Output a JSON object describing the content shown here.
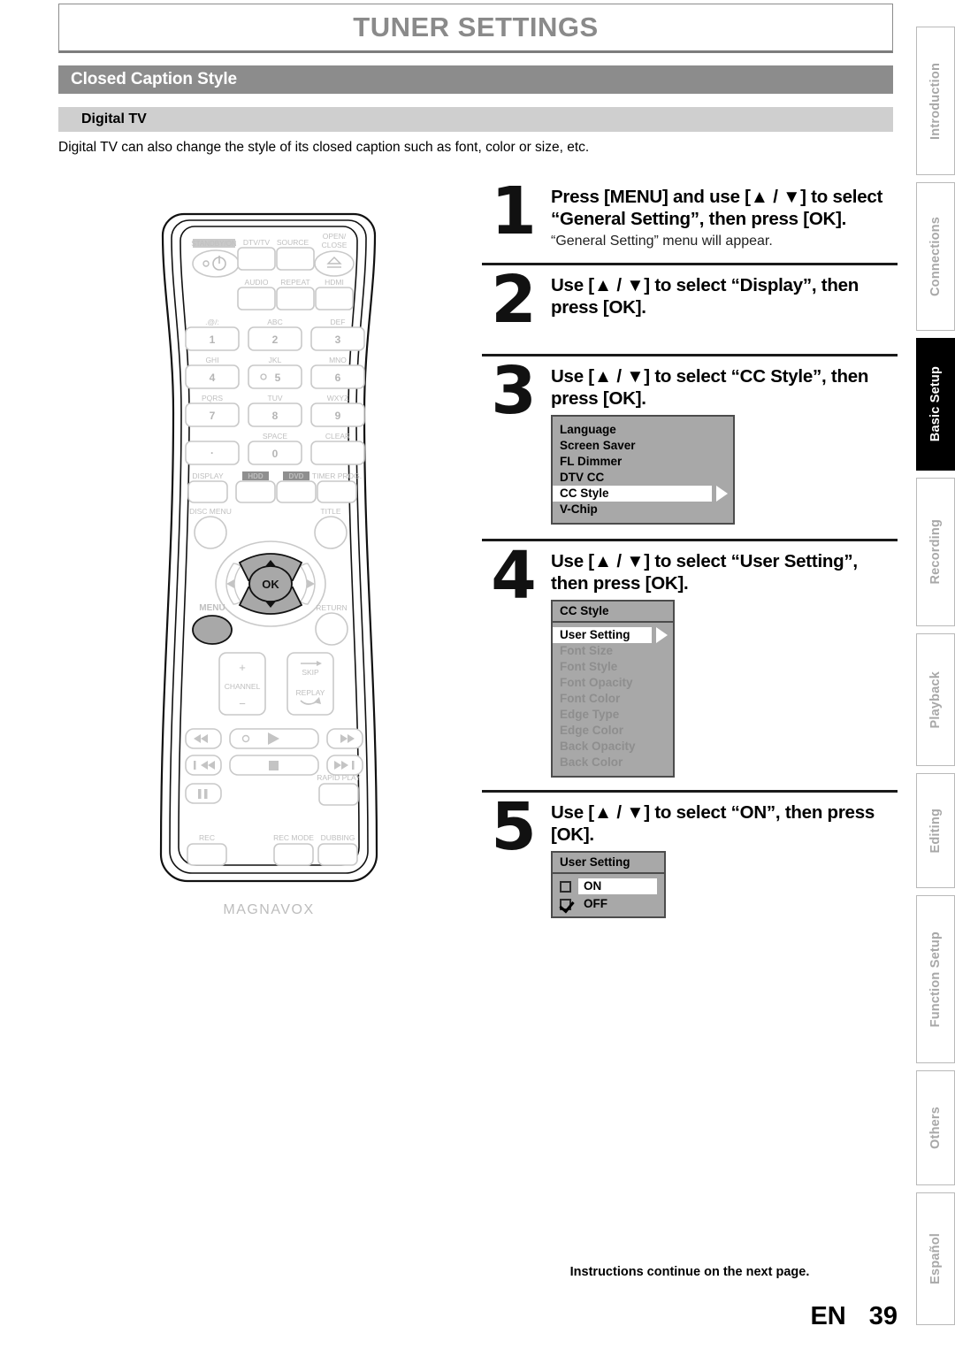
{
  "header": {
    "title": "TUNER SETTINGS",
    "section": "Closed Caption Style",
    "subsection": "Digital TV",
    "intro": "Digital TV can also change the style of its closed caption such as font, color or size, etc."
  },
  "tabs": [
    {
      "label": "Introduction",
      "active": false
    },
    {
      "label": "Connections",
      "active": false
    },
    {
      "label": "Basic Setup",
      "active": true
    },
    {
      "label": "Recording",
      "active": false
    },
    {
      "label": "Playback",
      "active": false
    },
    {
      "label": "Editing",
      "active": false
    },
    {
      "label": "Function Setup",
      "active": false
    },
    {
      "label": "Others",
      "active": false
    },
    {
      "label": "Español",
      "active": false
    }
  ],
  "steps": [
    {
      "number": "1",
      "title": "Press [MENU] and use [▲ / ▼] to select “General Setting”, then press [OK].",
      "subtitle": "“General Setting” menu will appear."
    },
    {
      "number": "2",
      "title": "Use [▲ / ▼] to select “Display”, then press [OK].",
      "subtitle": ""
    },
    {
      "number": "3",
      "title": "Use [▲ / ▼] to select “CC Style”, then press [OK].",
      "subtitle": ""
    },
    {
      "number": "4",
      "title": "Use [▲ / ▼] to select “User Setting”, then press [OK].",
      "subtitle": ""
    },
    {
      "number": "5",
      "title": "Use [▲ / ▼] to select “ON”, then press [OK].",
      "subtitle": ""
    }
  ],
  "osd_step3": {
    "items": [
      "Language",
      "Screen Saver",
      "FL Dimmer",
      "DTV CC",
      "CC Style",
      "V-Chip"
    ],
    "selected": "CC Style"
  },
  "osd_step4": {
    "header": "CC Style",
    "selected": "User Setting",
    "items": [
      "Font Size",
      "Font Style",
      "Font Opacity",
      "Font Color",
      "Edge Type",
      "Edge Color",
      "Back Opacity",
      "Back Color"
    ]
  },
  "osd_step5": {
    "header": "User Setting",
    "options": [
      {
        "label": "ON",
        "checked": false,
        "selected": true
      },
      {
        "label": "OFF",
        "checked": true,
        "selected": false
      }
    ]
  },
  "footer": {
    "note": "Instructions continue on the next page.",
    "lang": "EN",
    "page": "39"
  },
  "remote": {
    "brand": "MAGNAVOX",
    "standby_label": "STANDBY/ON",
    "buttons_row1": [
      "DTV/TV",
      "SOURCE"
    ],
    "open_close": "OPEN/\nCLOSE",
    "buttons_row2": [
      "AUDIO",
      "REPEAT",
      "HDMI"
    ],
    "keypad": [
      {
        "sub": ".@/:",
        "num": "1"
      },
      {
        "sub": "ABC",
        "num": "2"
      },
      {
        "sub": "DEF",
        "num": "3"
      },
      {
        "sub": "GHI",
        "num": "4"
      },
      {
        "sub": "JKL",
        "num": "5"
      },
      {
        "sub": "MNO",
        "num": "6"
      },
      {
        "sub": "PQRS",
        "num": "7"
      },
      {
        "sub": "TUV",
        "num": "8"
      },
      {
        "sub": "WXYZ",
        "num": "9"
      },
      {
        "sub": "",
        "num": "·"
      },
      {
        "sub": "SPACE",
        "num": "0"
      },
      {
        "sub": "CLEAR",
        "num": ""
      }
    ],
    "row_display": [
      "DISPLAY",
      "HDD",
      "DVD",
      "TIMER PROG."
    ],
    "disc_menu": "DISC MENU",
    "title": "TITLE",
    "ok": "OK",
    "menu": "MENU",
    "return": "RETURN",
    "channel": "CHANNEL",
    "channel_plus": "+",
    "channel_minus": "−",
    "skip": "SKIP",
    "replay": "REPLAY",
    "rapid_play": "RAPID PLAY",
    "rec": "REC",
    "rec_mode": "REC MODE",
    "dubbing": "DUBBING"
  }
}
